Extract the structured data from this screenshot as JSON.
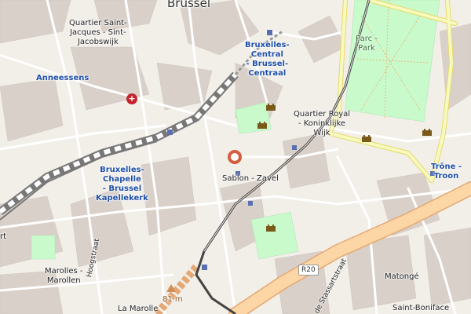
{
  "map": {
    "labels": {
      "brussel": "Brussel",
      "quartier_saint_jacques": "Quartier Saint-\nJacques - Sint-\nJacobswijk",
      "anneessens": "Anneessens",
      "bruxelles_central": "Bruxelles-\nCentral\n- Brussel-\nCentraal",
      "parc_park": "Parc -\nPark",
      "quartier_royal": "Quartier Royal\n- Koninklijke\nWijk",
      "bruxelles_chapelle": "Bruxelles-\nChapelle\n- Brussel\nKapellekerk",
      "sablon_zavel": "Sablon - Zavel",
      "trone_troon": "Trône -\nTroon",
      "marolles": "Marolles -\nMarollen",
      "hoogstraat": "Hoogstraat",
      "elevation": "81 m",
      "la_marolle": "La Marolle",
      "matonge": "Matongé",
      "saint_boniface": "Saint-Boniface",
      "stassartstraat": "de Stassartstraat",
      "rt": "rt"
    },
    "road_shield": "R20",
    "colors": {
      "land": "#f2efe9",
      "building": "#d9d0c9",
      "park": "#c8facc",
      "ring_road": "#fcd6a4",
      "primary": "#fcd6a4",
      "secondary": "#f7fabf",
      "railway": "#555555",
      "tram": "#444444",
      "marker": "#d65c3f",
      "station_label": "#1f4fa8"
    }
  }
}
